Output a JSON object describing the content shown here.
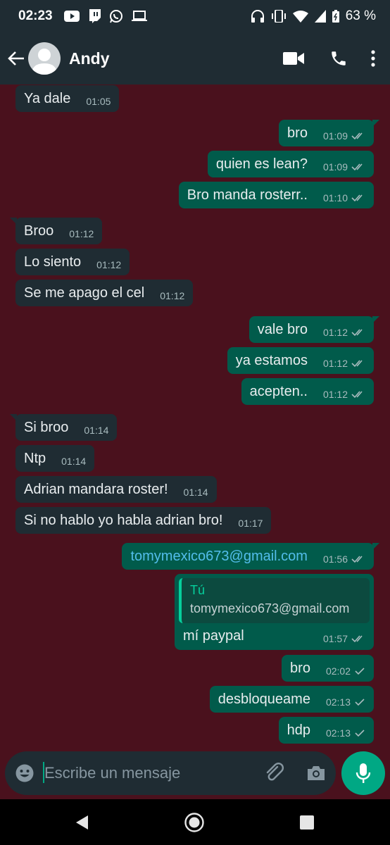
{
  "status_bar": {
    "time": "02:23",
    "battery": "63 %"
  },
  "header": {
    "contact_name": "Andy"
  },
  "messages": [
    {
      "dir": "in",
      "text": "Ya dale",
      "time": "01:05"
    },
    {
      "dir": "out",
      "text": "bro",
      "time": "01:09",
      "status": "read"
    },
    {
      "dir": "out",
      "text": "quien es lean?",
      "time": "01:09",
      "status": "read"
    },
    {
      "dir": "out",
      "text": "Bro manda rosterr..",
      "time": "01:10",
      "status": "read"
    },
    {
      "dir": "in",
      "text": "Broo",
      "time": "01:12"
    },
    {
      "dir": "in",
      "text": "Lo siento",
      "time": "01:12"
    },
    {
      "dir": "in",
      "text": "Se me apago el cel",
      "time": "01:12"
    },
    {
      "dir": "out",
      "text": "vale bro",
      "time": "01:12",
      "status": "read"
    },
    {
      "dir": "out",
      "text": "ya estamos",
      "time": "01:12",
      "status": "read"
    },
    {
      "dir": "out",
      "text": "acepten..",
      "time": "01:12",
      "status": "read"
    },
    {
      "dir": "in",
      "text": "Si broo",
      "time": "01:14"
    },
    {
      "dir": "in",
      "text": "Ntp",
      "time": "01:14"
    },
    {
      "dir": "in",
      "text": "Adrian mandara roster!",
      "time": "01:14"
    },
    {
      "dir": "in",
      "text": "Si no hablo yo habla adrian bro!",
      "time": "01:17"
    },
    {
      "dir": "out",
      "text": "tomymexico673@gmail.com",
      "time": "01:56",
      "status": "read"
    },
    {
      "dir": "out",
      "text": "mí paypal",
      "time": "01:57",
      "status": "read",
      "quote_author": "Tú",
      "quote_text": "tomymexico673@gmail.com"
    },
    {
      "dir": "out",
      "text": "bro",
      "time": "02:02",
      "status": "delivered"
    },
    {
      "dir": "out",
      "text": "desbloqueame",
      "time": "02:13",
      "status": "delivered"
    },
    {
      "dir": "out",
      "text": "hdp",
      "time": "02:13",
      "status": "delivered"
    }
  ],
  "composer": {
    "placeholder": "Escribe un mensaje"
  },
  "colors": {
    "background": "#4a111d",
    "bar": "#1f2c33",
    "incoming_bubble": "#1f2c33",
    "outgoing_bubble": "#015b4b",
    "accent": "#00a884",
    "link": "#53bdeb"
  },
  "icons": {
    "status_left": [
      "youtube-icon",
      "twitch-icon",
      "whatsapp-icon",
      "laptop-icon"
    ],
    "status_right": [
      "headphones-icon",
      "vibrate-icon",
      "wifi-icon",
      "signal-icon",
      "battery-icon"
    ],
    "header": [
      "back-arrow-icon",
      "avatar-icon",
      "video-call-icon",
      "phone-icon",
      "more-vert-icon"
    ],
    "composer": [
      "emoji-icon",
      "attach-icon",
      "camera-icon",
      "mic-icon"
    ],
    "navigation": [
      "nav-back-icon",
      "nav-home-icon",
      "nav-recents-icon"
    ]
  }
}
